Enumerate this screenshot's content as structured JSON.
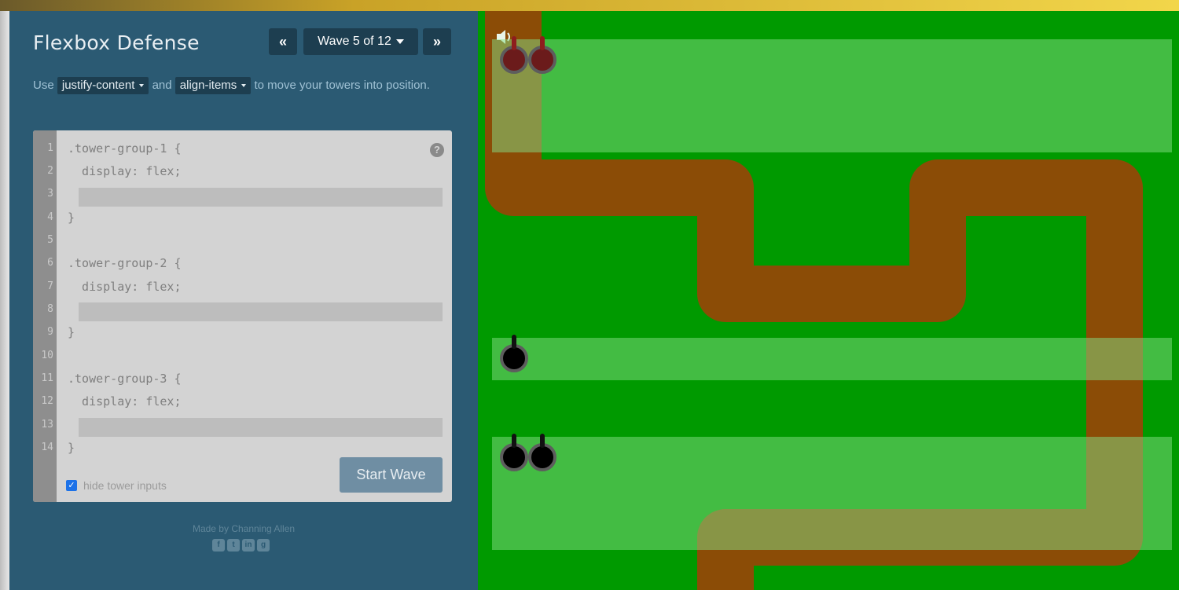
{
  "app": {
    "title": "Flexbox Defense"
  },
  "nav": {
    "prev_icon": "chevron-double-left-icon",
    "next_icon": "chevron-double-right-icon",
    "level_label": "Wave 5 of 12"
  },
  "instructions": {
    "part1": "Use",
    "prop1": "justify-content",
    "part2": "and",
    "prop2": "align-items",
    "part3": "to move your towers into position."
  },
  "editor": {
    "line_numbers": [
      "1",
      "2",
      "3",
      "4",
      "5",
      "6",
      "7",
      "8",
      "9",
      "10",
      "11",
      "12",
      "13",
      "14"
    ],
    "lines": {
      "l1": ".tower-group-1 {",
      "l2": "  display: flex;",
      "l4": "}",
      "l6": ".tower-group-2 {",
      "l7": "  display: flex;",
      "l9": "}",
      "l11": ".tower-group-3 {",
      "l12": "  display: flex;",
      "l14": "}"
    },
    "inputs": {
      "group1": "",
      "group2": "",
      "group3": ""
    },
    "help_glyph": "?",
    "hide_inputs_label": "hide tower inputs",
    "hide_inputs_checked": true,
    "start_button": "Start Wave"
  },
  "footer": {
    "credit": "Made by Channing Allen",
    "social_icons": [
      "facebook-icon",
      "twitter-icon",
      "linkedin-icon",
      "github-icon"
    ]
  },
  "colors": {
    "sidebar": "#2b5a73",
    "grass": "#009a00",
    "path": "#8b4c06",
    "tower_red": "#6b1b1b",
    "tower_black": "#000000"
  }
}
